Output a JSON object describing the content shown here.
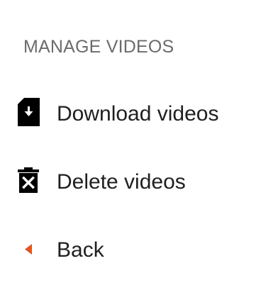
{
  "menu": {
    "header": "MANAGE VIDEOS",
    "items": [
      {
        "label": "Download videos",
        "icon": "download-file-icon"
      },
      {
        "label": "Delete videos",
        "icon": "delete-trash-icon"
      },
      {
        "label": "Back",
        "icon": "back-arrow-icon"
      }
    ]
  },
  "colors": {
    "header_text": "#6b6b6b",
    "item_text": "#202020",
    "icon": "#000000",
    "back_accent": "#e8531f"
  }
}
